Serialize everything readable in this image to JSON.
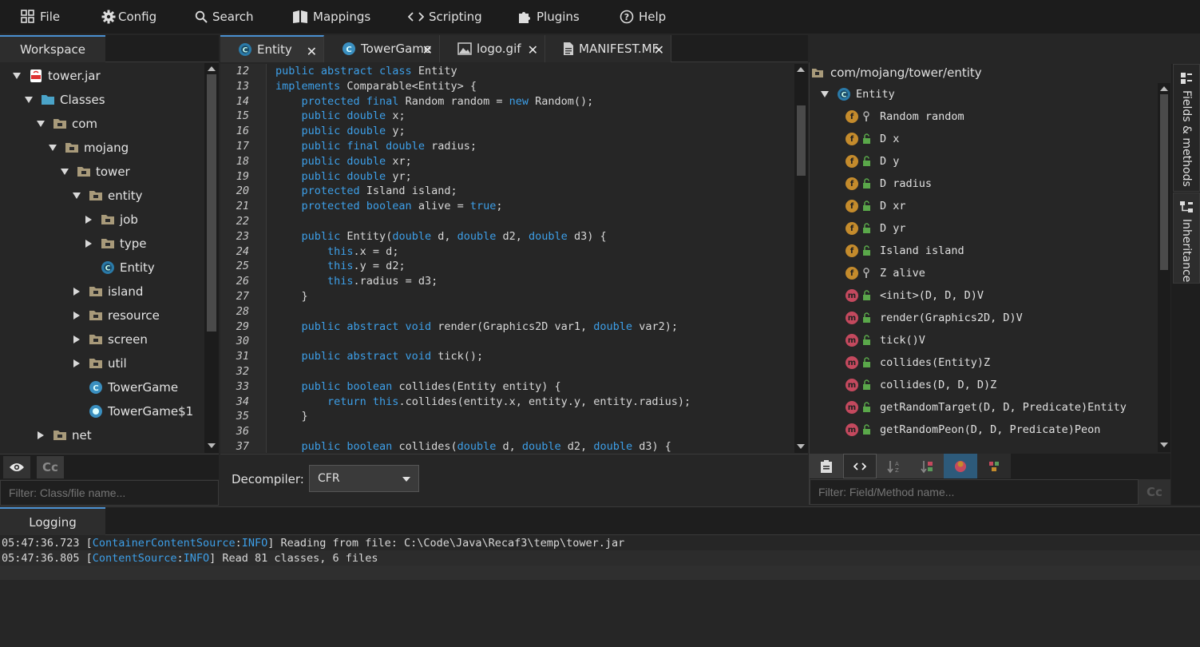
{
  "menu": {
    "file": "File",
    "config": "Config",
    "search": "Search",
    "mappings": "Mappings",
    "scripting": "Scripting",
    "plugins": "Plugins",
    "help": "Help"
  },
  "workspace": {
    "tab": "Workspace",
    "tree": [
      {
        "label": "tower.jar",
        "depth": 0,
        "expand": "down",
        "icon": "jar-icon"
      },
      {
        "label": "Classes",
        "depth": 1,
        "expand": "down",
        "icon": "folder-blue-icon"
      },
      {
        "label": "com",
        "depth": 2,
        "expand": "down",
        "icon": "package-icon"
      },
      {
        "label": "mojang",
        "depth": 3,
        "expand": "down",
        "icon": "package-icon"
      },
      {
        "label": "tower",
        "depth": 4,
        "expand": "down",
        "icon": "package-icon"
      },
      {
        "label": "entity",
        "depth": 5,
        "expand": "down",
        "icon": "package-icon"
      },
      {
        "label": "job",
        "depth": 6,
        "expand": "right",
        "icon": "package-icon"
      },
      {
        "label": "type",
        "depth": 6,
        "expand": "right",
        "icon": "package-icon"
      },
      {
        "label": "Entity",
        "depth": 6,
        "expand": "none",
        "icon": "abstract-class-icon"
      },
      {
        "label": "island",
        "depth": 5,
        "expand": "right",
        "icon": "package-icon"
      },
      {
        "label": "resource",
        "depth": 5,
        "expand": "right",
        "icon": "package-icon"
      },
      {
        "label": "screen",
        "depth": 5,
        "expand": "right",
        "icon": "package-icon"
      },
      {
        "label": "util",
        "depth": 5,
        "expand": "right",
        "icon": "package-icon"
      },
      {
        "label": "TowerGame",
        "depth": 5,
        "expand": "none",
        "icon": "class-icon"
      },
      {
        "label": "TowerGame$1",
        "depth": 5,
        "expand": "none",
        "icon": "inner-class-icon"
      },
      {
        "label": "net",
        "depth": 2,
        "expand": "right",
        "icon": "package-icon"
      }
    ],
    "case_toggle": "Cc",
    "filter_placeholder": "Filter: Class/file name..."
  },
  "editor": {
    "tabs": [
      {
        "label": "Entity",
        "icon": "abstract-class-icon"
      },
      {
        "label": "TowerGame",
        "icon": "class-icon"
      },
      {
        "label": "logo.gif",
        "icon": "image-icon"
      },
      {
        "label": "MANIFEST.MF",
        "icon": "file-icon"
      }
    ],
    "close_glyph": "✕",
    "lines": [
      {
        "n": "12",
        "t": [
          [
            "kw",
            "public abstract class "
          ],
          [
            "",
            "Entity"
          ]
        ]
      },
      {
        "n": "13",
        "t": [
          [
            "kw",
            "implements "
          ],
          [
            "",
            "Comparable<Entity> {"
          ]
        ]
      },
      {
        "n": "14",
        "t": [
          [
            "",
            "    "
          ],
          [
            "kw",
            "protected final "
          ],
          [
            "",
            "Random random = "
          ],
          [
            "kw",
            "new "
          ],
          [
            "",
            "Random();"
          ]
        ]
      },
      {
        "n": "15",
        "t": [
          [
            "",
            "    "
          ],
          [
            "kw",
            "public double "
          ],
          [
            "",
            "x;"
          ]
        ]
      },
      {
        "n": "16",
        "t": [
          [
            "",
            "    "
          ],
          [
            "kw",
            "public double "
          ],
          [
            "",
            "y;"
          ]
        ]
      },
      {
        "n": "17",
        "t": [
          [
            "",
            "    "
          ],
          [
            "kw",
            "public final double "
          ],
          [
            "",
            "radius;"
          ]
        ]
      },
      {
        "n": "18",
        "t": [
          [
            "",
            "    "
          ],
          [
            "kw",
            "public double "
          ],
          [
            "",
            "xr;"
          ]
        ]
      },
      {
        "n": "19",
        "t": [
          [
            "",
            "    "
          ],
          [
            "kw",
            "public double "
          ],
          [
            "",
            "yr;"
          ]
        ]
      },
      {
        "n": "20",
        "t": [
          [
            "",
            "    "
          ],
          [
            "kw",
            "protected "
          ],
          [
            "",
            "Island island;"
          ]
        ]
      },
      {
        "n": "21",
        "t": [
          [
            "",
            "    "
          ],
          [
            "kw",
            "protected boolean "
          ],
          [
            "",
            "alive = "
          ],
          [
            "kw",
            "true"
          ],
          [
            "",
            ";"
          ]
        ]
      },
      {
        "n": "22",
        "t": []
      },
      {
        "n": "23",
        "t": [
          [
            "",
            "    "
          ],
          [
            "kw",
            "public "
          ],
          [
            "",
            "Entity("
          ],
          [
            "kw",
            "double "
          ],
          [
            "",
            "d, "
          ],
          [
            "kw",
            "double "
          ],
          [
            "",
            "d2, "
          ],
          [
            "kw",
            "double "
          ],
          [
            "",
            "d3) {"
          ]
        ]
      },
      {
        "n": "24",
        "t": [
          [
            "",
            "        "
          ],
          [
            "kw",
            "this"
          ],
          [
            "",
            ".x = d;"
          ]
        ]
      },
      {
        "n": "25",
        "t": [
          [
            "",
            "        "
          ],
          [
            "kw",
            "this"
          ],
          [
            "",
            ".y = d2;"
          ]
        ]
      },
      {
        "n": "26",
        "t": [
          [
            "",
            "        "
          ],
          [
            "kw",
            "this"
          ],
          [
            "",
            ".radius = d3;"
          ]
        ]
      },
      {
        "n": "27",
        "t": [
          [
            "",
            "    }"
          ]
        ]
      },
      {
        "n": "28",
        "t": []
      },
      {
        "n": "29",
        "t": [
          [
            "",
            "    "
          ],
          [
            "kw",
            "public abstract void "
          ],
          [
            "",
            "render(Graphics2D var1, "
          ],
          [
            "kw",
            "double "
          ],
          [
            "",
            "var2);"
          ]
        ]
      },
      {
        "n": "30",
        "t": []
      },
      {
        "n": "31",
        "t": [
          [
            "",
            "    "
          ],
          [
            "kw",
            "public abstract void "
          ],
          [
            "",
            "tick();"
          ]
        ]
      },
      {
        "n": "32",
        "t": []
      },
      {
        "n": "33",
        "t": [
          [
            "",
            "    "
          ],
          [
            "kw",
            "public boolean "
          ],
          [
            "",
            "collides(Entity entity) {"
          ]
        ]
      },
      {
        "n": "34",
        "t": [
          [
            "",
            "        "
          ],
          [
            "kw",
            "return this"
          ],
          [
            "",
            ".collides(entity.x, entity.y, entity.radius);"
          ]
        ]
      },
      {
        "n": "35",
        "t": [
          [
            "",
            "    }"
          ]
        ]
      },
      {
        "n": "36",
        "t": []
      },
      {
        "n": "37",
        "t": [
          [
            "",
            "    "
          ],
          [
            "kw",
            "public boolean "
          ],
          [
            "",
            "collides("
          ],
          [
            "kw",
            "double "
          ],
          [
            "",
            "d, "
          ],
          [
            "kw",
            "double "
          ],
          [
            "",
            "d2, "
          ],
          [
            "kw",
            "double "
          ],
          [
            "",
            "d3) {"
          ]
        ]
      }
    ],
    "decompiler_label": "Decompiler:",
    "decompiler_value": "CFR"
  },
  "fields": {
    "path": "com/mojang/tower/entity",
    "root": "Entity",
    "items": [
      {
        "kind": "f",
        "label": "Random random",
        "mod": "private-icon"
      },
      {
        "kind": "f",
        "label": "D x",
        "mod": "public-icon"
      },
      {
        "kind": "f",
        "label": "D y",
        "mod": "public-icon"
      },
      {
        "kind": "f",
        "label": "D radius",
        "mod": "public-icon"
      },
      {
        "kind": "f",
        "label": "D xr",
        "mod": "public-icon"
      },
      {
        "kind": "f",
        "label": "D yr",
        "mod": "public-icon"
      },
      {
        "kind": "f",
        "label": "Island island",
        "mod": "public-icon"
      },
      {
        "kind": "f",
        "label": "Z alive",
        "mod": "private-icon"
      },
      {
        "kind": "m",
        "label": "<init>(D, D, D)V",
        "mod": "public-icon"
      },
      {
        "kind": "m",
        "label": "render(Graphics2D, D)V",
        "mod": "public-icon"
      },
      {
        "kind": "m",
        "label": "tick()V",
        "mod": "public-icon"
      },
      {
        "kind": "m",
        "label": "collides(Entity)Z",
        "mod": "public-icon"
      },
      {
        "kind": "m",
        "label": "collides(D, D, D)Z",
        "mod": "public-icon"
      },
      {
        "kind": "m",
        "label": "getRandomTarget(D, D, Predicate)Entity",
        "mod": "public-icon"
      },
      {
        "kind": "m",
        "label": "getRandomPeon(D, D, Predicate)Peon",
        "mod": "public-icon"
      }
    ],
    "case_toggle": "Cc",
    "filter_placeholder": "Filter: Field/Method name...",
    "side_tabs": {
      "fields_methods": "Fields & methods",
      "inheritance": "Inheritance"
    }
  },
  "logging": {
    "tab": "Logging",
    "lines": [
      {
        "time": "05:47:36.723 [",
        "src": "ContainerContentSource",
        "sep": ":",
        "lvl": "INFO",
        "msg": "] Reading from file: C:\\Code\\Java\\Recaf3\\temp\\tower.jar"
      },
      {
        "time": "05:47:36.805 [",
        "src": "ContentSource",
        "sep": ":",
        "lvl": "INFO",
        "msg": "] Read 81 classes, 6 files"
      }
    ]
  },
  "colors": {
    "accent": "#4a8fd0",
    "keyword": "#3d9fe8",
    "field": "#c48b2c",
    "method": "#c4495e"
  }
}
